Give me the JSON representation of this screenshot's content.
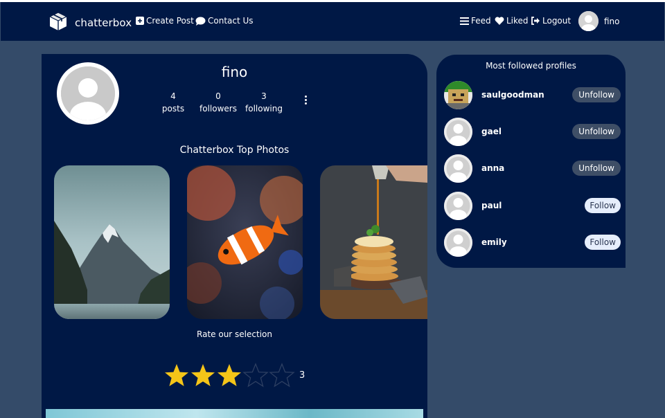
{
  "navbar": {
    "brand": "chatterbox",
    "create_post": "Create Post",
    "contact_us": "Contact Us",
    "feed": "Feed",
    "liked": "Liked",
    "logout": "Logout",
    "username": "fino"
  },
  "profile": {
    "name": "fino",
    "stats": [
      {
        "value": "4",
        "label": "posts"
      },
      {
        "value": "0",
        "label": "followers"
      },
      {
        "value": "3",
        "label": "following"
      }
    ]
  },
  "top_photos": {
    "title": "Chatterbox Top Photos",
    "photos": [
      "mountain-lake",
      "clownfish",
      "pancakes-syrup"
    ]
  },
  "rating": {
    "label": "Rate our selection",
    "value": "3",
    "max": 5,
    "filled_color": "#f5c518"
  },
  "most_followed": {
    "title": "Most followed profiles",
    "profiles": [
      {
        "name": "saulgoodman",
        "action": "Unfollow"
      },
      {
        "name": "gael",
        "action": "Unfollow"
      },
      {
        "name": "anna",
        "action": "Unfollow"
      },
      {
        "name": "paul",
        "action": "Follow"
      },
      {
        "name": "emily",
        "action": "Follow"
      }
    ]
  },
  "colors": {
    "navy": "#001845",
    "background": "#344b69",
    "star": "#f5c518"
  }
}
